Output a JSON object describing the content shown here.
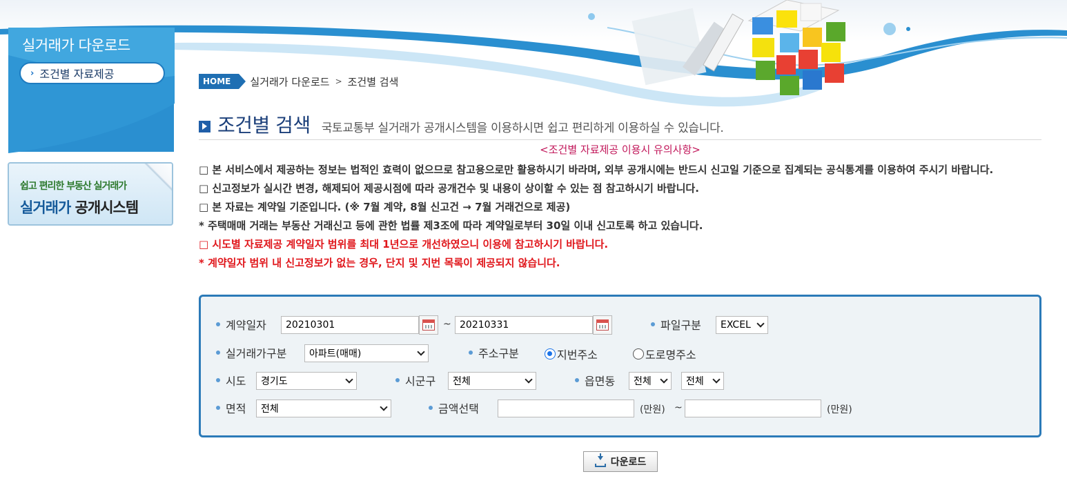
{
  "sidebar": {
    "title": "실거래가 다운로드",
    "items": [
      {
        "label": "조건별 자료제공"
      }
    ],
    "banner": {
      "line1": "쉽고 편리한 부동산 실거래가",
      "line2_a": "실거래가",
      "line2_b": "공개시스템"
    }
  },
  "breadcrumb": {
    "home": "HOME",
    "path": [
      "실거래가 다운로드",
      "조건별 검색"
    ],
    "separator": ">"
  },
  "page": {
    "title": "조건별 검색",
    "description": "국토교통부 실거래가 공개시스템을 이용하시면 쉽고 편리하게 이용하실 수 있습니다."
  },
  "notices": {
    "heading": "<조건별 자료제공 이용시 유의사항>",
    "items": [
      "□ 본 서비스에서 제공하는 정보는 법적인 효력이 없으므로 참고용으로만 활용하시기 바라며, 외부 공개시에는 반드시 신고일 기준으로 집계되는 공식통계를 이용하여 주시기 바랍니다.",
      "□ 신고정보가 실시간 변경, 해제되어 제공시점에 따라 공개건수 및 내용이 상이할 수 있는 점 참고하시기 바랍니다.",
      "□ 본 자료는 계약일 기준입니다. (※ 7월 계약, 8월 신고건 → 7월 거래건으로 제공)",
      "* 주택매매 거래는 부동산 거래신고 등에 관한 법률 제3조에 따라 계약일로부터 30일 이내 신고토록 하고 있습니다."
    ],
    "red_items": [
      "□ 시도별 자료제공 계약일자 범위를 최대 1년으로 개선하였으니 이용에 참고하시기 바랍니다.",
      "* 계약일자 범위 내 신고정보가 없는 경우, 단지 및 지번 목록이 제공되지 않습니다."
    ]
  },
  "form": {
    "contract_date": {
      "label": "계약일자",
      "from": "20210301",
      "to": "20210331",
      "tilde": "~"
    },
    "file_type": {
      "label": "파일구분",
      "value": "EXCEL"
    },
    "deal_type": {
      "label": "실거래가구분",
      "value": "아파트(매매)"
    },
    "address_type": {
      "label": "주소구분",
      "options": [
        "지번주소",
        "도로명주소"
      ],
      "selected": "지번주소"
    },
    "sido": {
      "label": "시도",
      "value": "경기도"
    },
    "sigungu": {
      "label": "시군구",
      "value": "전체"
    },
    "eupmyeondong": {
      "label": "읍면동",
      "value1": "전체",
      "value2": "전체"
    },
    "area": {
      "label": "면적",
      "value": "전체"
    },
    "amount": {
      "label": "금액선택",
      "from": "",
      "to": "",
      "unit": "(만원)",
      "tilde": "~"
    }
  },
  "actions": {
    "download_label": "다운로드"
  },
  "colors": {
    "brand_blue": "#2b7ab8",
    "notice_red": "#e0161b",
    "notice_heading": "#c2185b",
    "title_navy": "#1b3f7a"
  }
}
